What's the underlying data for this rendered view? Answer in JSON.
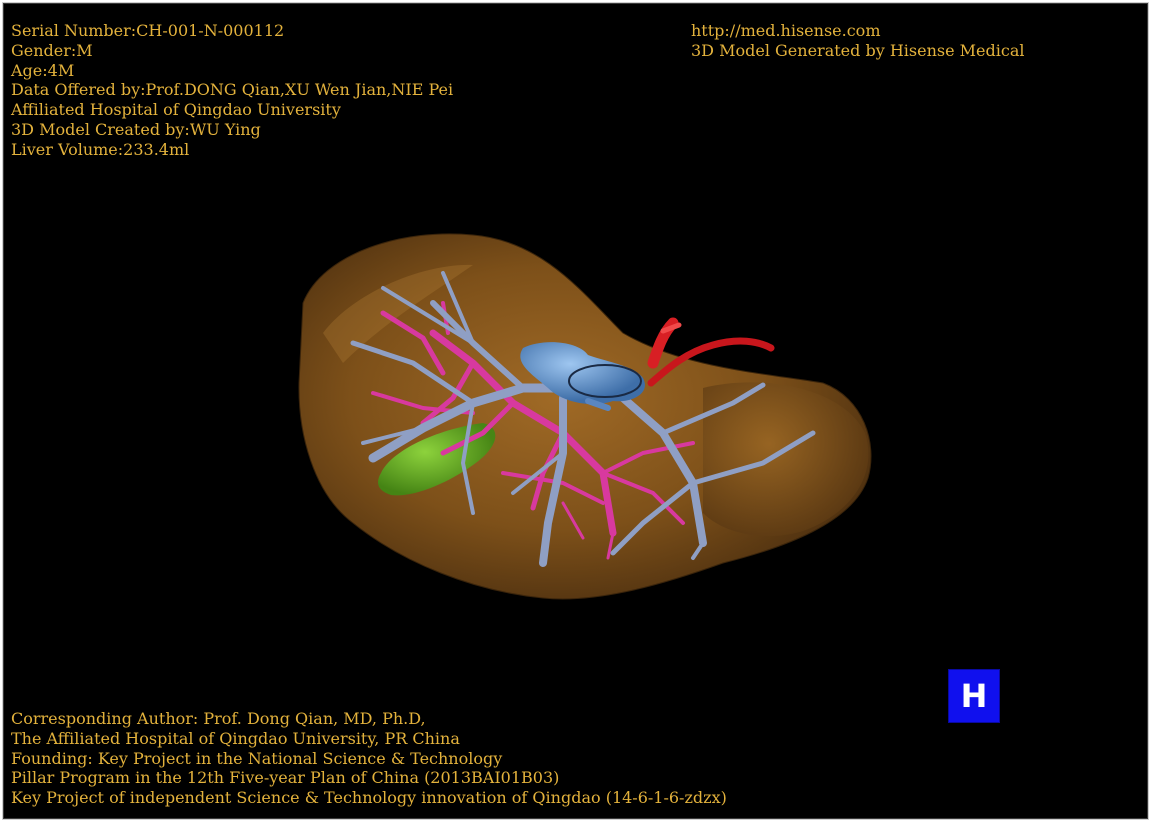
{
  "patient_info": {
    "serial_number": "Serial Number:CH-001-N-000112",
    "gender": "Gender:M",
    "age": "Age:4M",
    "data_offered_by": "Data Offered by:Prof.DONG Qian,XU Wen Jian,NIE Pei",
    "hospital": "Affiliated Hospital of Qingdao University",
    "model_created_by": "3D Model Created by:WU Ying",
    "liver_volume": "Liver Volume:233.4ml"
  },
  "site_info": {
    "url": "http://med.hisense.com",
    "generated_by": "3D Model Generated by Hisense Medical"
  },
  "credits": {
    "line1": "Corresponding Author: Prof. Dong Qian, MD, Ph.D,",
    "line2": "The Affiliated Hospital of Qingdao University, PR China",
    "line3": "Founding: Key Project in the National Science & Technology",
    "line4": "Pillar Program in the 12th Five-year Plan of China (2013BAI01B03)",
    "line5": "Key Project of independent Science & Technology innovation of Qingdao (14-6-1-6-zdzx)"
  },
  "logo": {
    "letter": "H"
  },
  "colors": {
    "background": "#000000",
    "text": "#e3b23c",
    "liver": "#8a5a1e",
    "portal_vein": "#8f9fc4",
    "hepatic_vein": "#d8399f",
    "artery": "#c8161c",
    "gallbladder": "#6fbf2a",
    "logo_bg": "#1010ee"
  }
}
